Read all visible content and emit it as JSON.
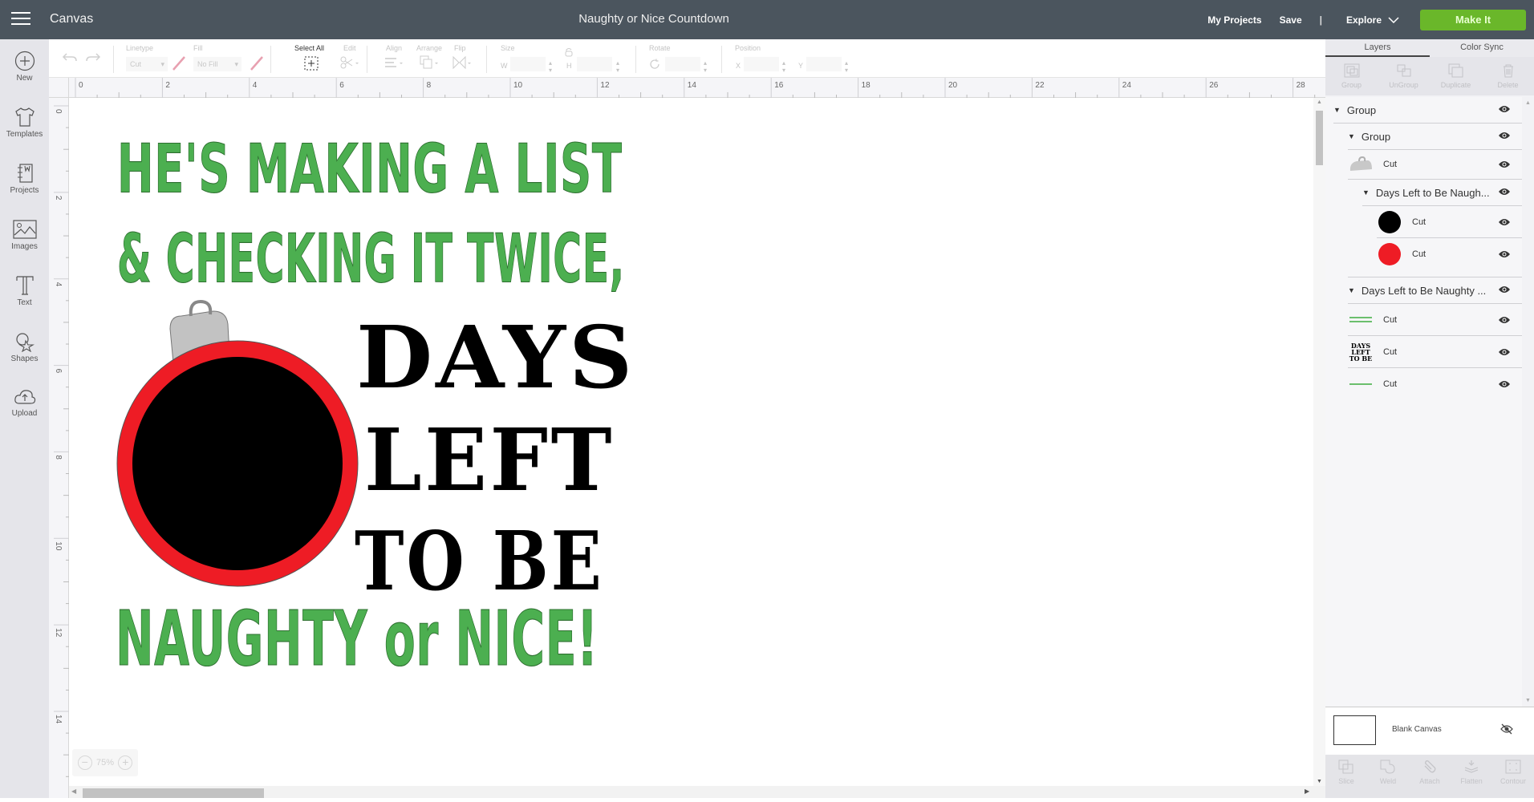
{
  "topbar": {
    "app_title": "Canvas",
    "document_title": "Naughty or Nice Countdown",
    "my_projects": "My Projects",
    "save": "Save",
    "separator": "|",
    "explore": "Explore",
    "make_it": "Make It",
    "make_it_color": "#6ab72a"
  },
  "sidebar": {
    "items": [
      {
        "label": "New",
        "icon": "plus-circle-icon"
      },
      {
        "label": "Templates",
        "icon": "shirt-icon"
      },
      {
        "label": "Projects",
        "icon": "notebook-icon"
      },
      {
        "label": "Images",
        "icon": "image-icon"
      },
      {
        "label": "Text",
        "icon": "text-icon"
      },
      {
        "label": "Shapes",
        "icon": "shapes-icon"
      },
      {
        "label": "Upload",
        "icon": "cloud-upload-icon"
      }
    ]
  },
  "toolbar": {
    "linetype_label": "Linetype",
    "linetype_value": "Cut",
    "fill_label": "Fill",
    "fill_value": "No Fill",
    "select_all_label": "Select All",
    "edit_label": "Edit",
    "align_label": "Align",
    "arrange_label": "Arrange",
    "flip_label": "Flip",
    "size_label": "Size",
    "w_label": "W",
    "h_label": "H",
    "rotate_label": "Rotate",
    "position_label": "Position",
    "x_label": "X",
    "y_label": "Y"
  },
  "rulers": {
    "horizontal": [
      "0",
      "2",
      "4",
      "6",
      "8",
      "10",
      "12",
      "14",
      "16",
      "18",
      "20",
      "22",
      "24",
      "26",
      "28"
    ],
    "vertical": [
      "0",
      "2",
      "4",
      "6",
      "8",
      "10",
      "12",
      "14"
    ]
  },
  "zoom": {
    "value": "75%",
    "minus": "−",
    "plus": "+"
  },
  "artwork": {
    "line1": "HE'S MAKING A LIST",
    "line2": "& CHECKING IT TWICE,",
    "line3": "DAYS",
    "line4": "LEFT",
    "line5": "TO BE",
    "line6": "NAUGHTY or NICE!",
    "green": "#4caf50",
    "red": "#ee1c25",
    "black": "#000000",
    "cap_gray": "#c2c2c2"
  },
  "right_panel": {
    "tabs": [
      {
        "label": "Layers",
        "active": true
      },
      {
        "label": "Color Sync",
        "active": false
      }
    ],
    "layer_tools": [
      "Group",
      "UnGroup",
      "Duplicate",
      "Delete"
    ],
    "layers": [
      {
        "name": "Group",
        "level": 0,
        "type": "group"
      },
      {
        "name": "Group",
        "level": 1,
        "type": "group"
      },
      {
        "name": "Cut",
        "level": 1,
        "type": "cut",
        "thumb": "ornament-cap"
      },
      {
        "name": "Days Left to Be Naugh...",
        "level": 2,
        "type": "group"
      },
      {
        "name": "Cut",
        "level": 2,
        "type": "cut",
        "thumb": "black-circle"
      },
      {
        "name": "Cut",
        "level": 2,
        "type": "cut",
        "thumb": "red-circle"
      },
      {
        "name": "Days Left to Be Naughty ...",
        "level": 0,
        "type": "group"
      },
      {
        "name": "Cut",
        "level": 1,
        "type": "cut",
        "thumb": "green-text-top"
      },
      {
        "name": "Cut",
        "level": 1,
        "type": "cut",
        "thumb": "days-left-to-be"
      },
      {
        "name": "Cut",
        "level": 1,
        "type": "cut",
        "thumb": "green-text-bottom"
      }
    ],
    "thumb_days_text": [
      "DAYS",
      "LEFT",
      "TO BE"
    ],
    "blank_canvas": "Blank Canvas",
    "bottom_tools": [
      "Slice",
      "Weld",
      "Attach",
      "Flatten",
      "Contour"
    ]
  }
}
